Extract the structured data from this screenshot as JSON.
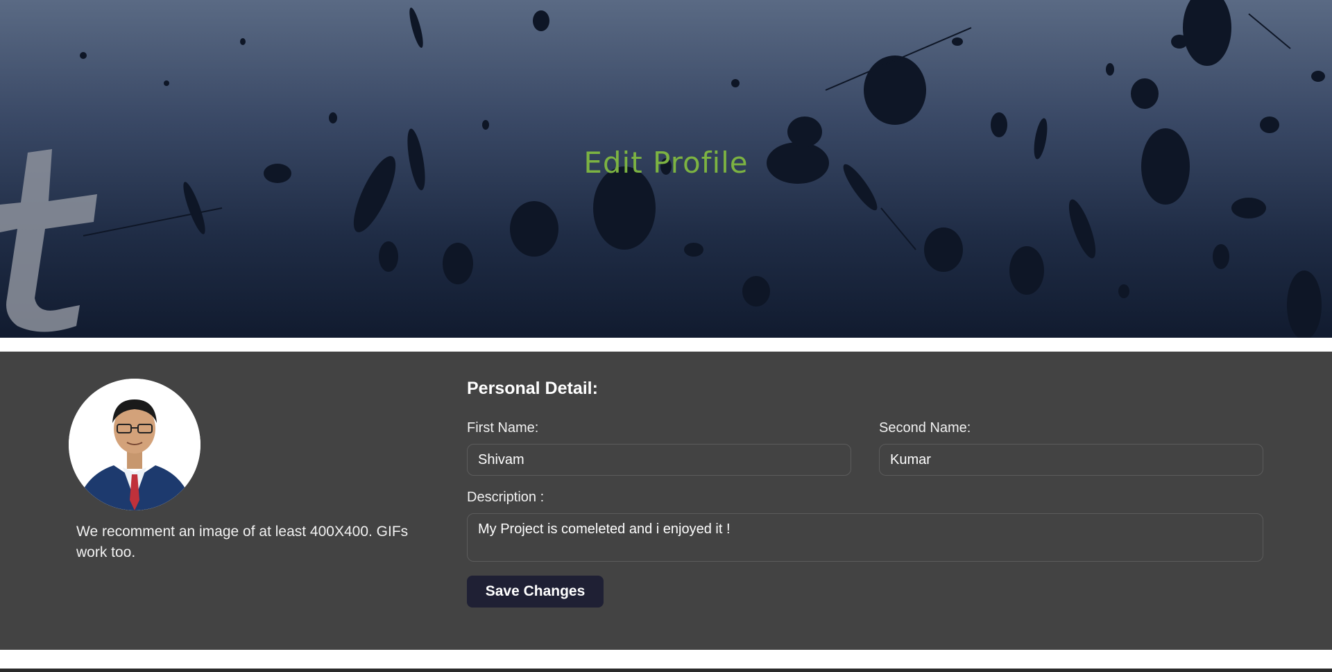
{
  "hero": {
    "title": "Edit Profile"
  },
  "profile": {
    "avatar_alt": "profile-photo",
    "image_note": "We recomment an image of at least 400X400. GIFs work too."
  },
  "form": {
    "heading": "Personal Detail:",
    "first_name_label": "First Name:",
    "first_name_value": "Shivam",
    "second_name_label": "Second Name:",
    "second_name_value": "Kumar",
    "description_label": "Description :",
    "description_value": "My Project is comeleted and i enjoyed it !",
    "save_label": "Save Changes"
  },
  "colors": {
    "title_accent": "#7cb342",
    "panel_bg": "#434343",
    "button_bg": "#1f2034"
  }
}
